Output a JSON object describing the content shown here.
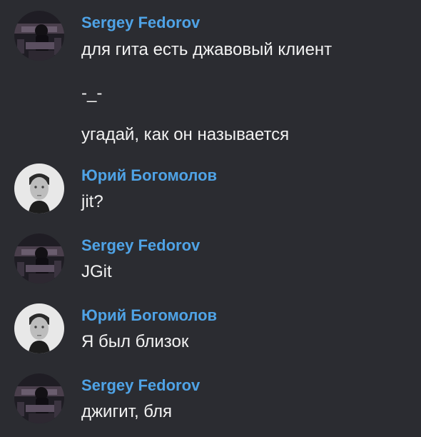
{
  "messages": [
    {
      "author": "Sergey Fedorov",
      "avatar": "sergey-avatar",
      "lines": [
        "для гита есть джавовый клиент",
        "-_-",
        "угадай, как он называется"
      ]
    },
    {
      "author": "Юрий Богомолов",
      "avatar": "yuri-avatar",
      "lines": [
        "jit?"
      ]
    },
    {
      "author": "Sergey Fedorov",
      "avatar": "sergey-avatar",
      "lines": [
        "JGit"
      ]
    },
    {
      "author": "Юрий Богомолов",
      "avatar": "yuri-avatar",
      "lines": [
        "Я был близок"
      ]
    },
    {
      "author": "Sergey Fedorov",
      "avatar": "sergey-avatar",
      "lines": [
        "джигит, бля"
      ]
    }
  ],
  "colors": {
    "background": "#2b2c31",
    "author_name": "#4fa3e6",
    "message_text": "#f2f2f2"
  }
}
